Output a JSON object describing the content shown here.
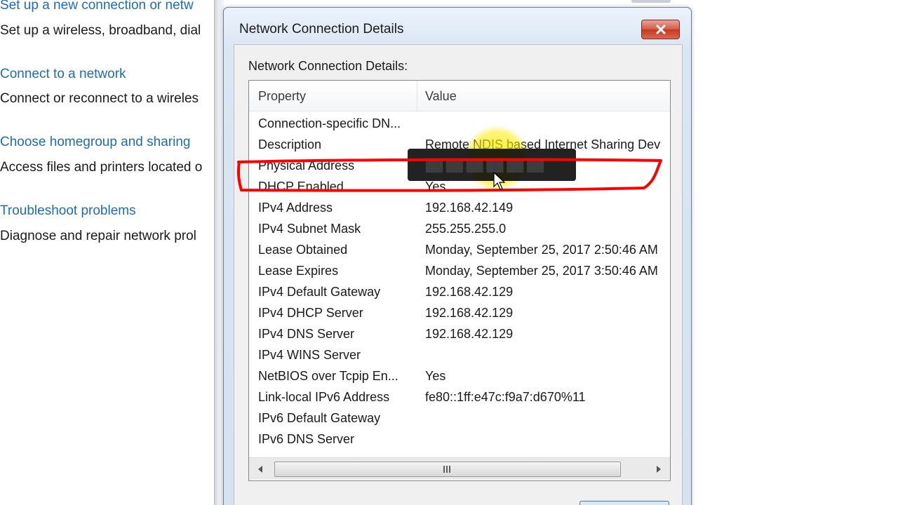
{
  "background_panel": {
    "items": [
      {
        "link": "Set up a new connection or netw",
        "desc": "Set up a wireless, broadband, dial"
      },
      {
        "link": "Connect to a network",
        "desc": "Connect or reconnect to a wireles"
      },
      {
        "link": "Choose homegroup and sharing",
        "desc": "Access files and printers located o"
      },
      {
        "link": "Troubleshoot problems",
        "desc": "Diagnose and repair network prol"
      }
    ]
  },
  "dialog": {
    "title": "Network Connection Details",
    "close_icon": "close-x-icon",
    "group_label": "Network Connection Details:",
    "columns": {
      "property": "Property",
      "value": "Value"
    },
    "rows": [
      {
        "property": "Connection-specific DN...",
        "value": ""
      },
      {
        "property": "Description",
        "value": "Remote NDIS based Internet Sharing Dev"
      },
      {
        "property": "Physical Address",
        "value": ""
      },
      {
        "property": "DHCP Enabled",
        "value": "Yes"
      },
      {
        "property": "IPv4 Address",
        "value": "192.168.42.149"
      },
      {
        "property": "IPv4 Subnet Mask",
        "value": "255.255.255.0"
      },
      {
        "property": "Lease Obtained",
        "value": "Monday, September 25, 2017 2:50:46 AM"
      },
      {
        "property": "Lease Expires",
        "value": "Monday, September 25, 2017 3:50:46 AM"
      },
      {
        "property": "IPv4 Default Gateway",
        "value": "192.168.42.129"
      },
      {
        "property": "IPv4 DHCP Server",
        "value": "192.168.42.129"
      },
      {
        "property": "IPv4 DNS Server",
        "value": "192.168.42.129"
      },
      {
        "property": "IPv4 WINS Server",
        "value": ""
      },
      {
        "property": "NetBIOS over Tcpip En...",
        "value": "Yes"
      },
      {
        "property": "Link-local IPv6 Address",
        "value": "fe80::1ff:e47c:f9a7:d670%11"
      },
      {
        "property": "IPv6 Default Gateway",
        "value": ""
      },
      {
        "property": "IPv6 DNS Server",
        "value": ""
      }
    ],
    "scrollbar": {
      "left_icon": "scroll-left-arrow-icon",
      "right_icon": "scroll-right-arrow-icon"
    }
  },
  "tooltip": {
    "text": "██ ██ ██ ██ ██ ██"
  },
  "annotation": {
    "highlight_color": "#ffeb00",
    "outline_color": "#ff0000"
  }
}
